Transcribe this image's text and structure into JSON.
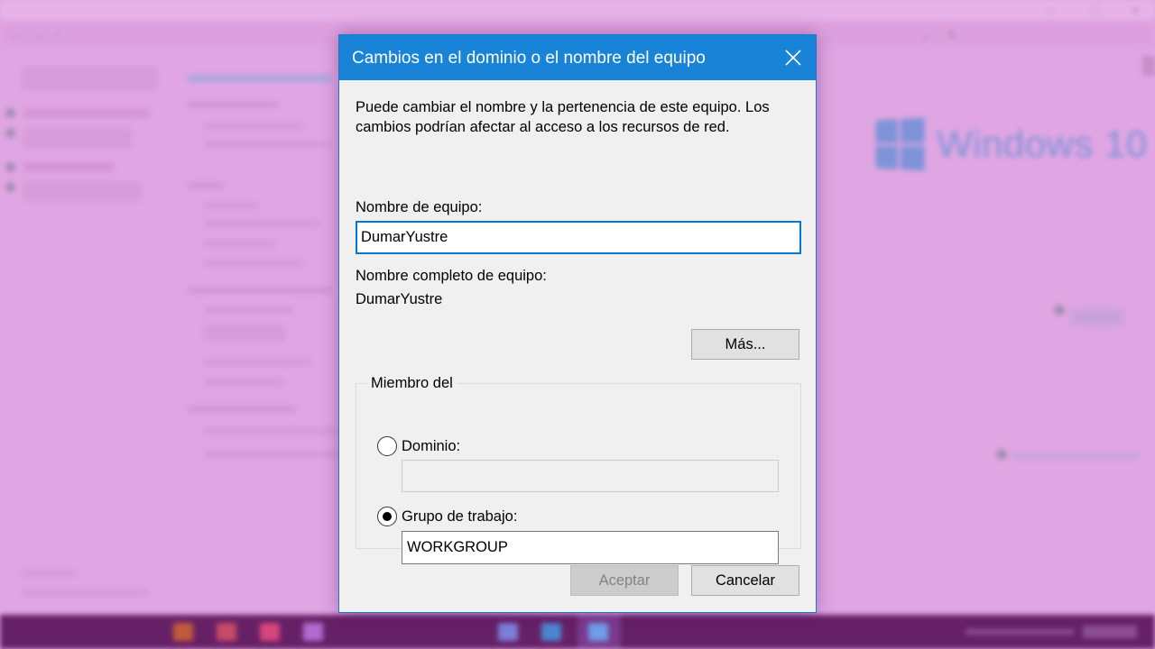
{
  "dialog": {
    "title": "Cambios en el dominio o el nombre del equipo",
    "description": "Puede cambiar el nombre y la pertenencia de este equipo. Los cambios podrían afectar al acceso a los recursos de red.",
    "computer_name_label": "Nombre de equipo:",
    "computer_name_value": "DumarYustre",
    "full_name_label": "Nombre completo de equipo:",
    "full_name_value": "DumarYustre",
    "more_button": "Más...",
    "member_of_legend": "Miembro del",
    "domain_option": "Dominio:",
    "domain_value": "",
    "workgroup_option": "Grupo de trabajo:",
    "workgroup_value": "WORKGROUP",
    "selected_option": "workgroup",
    "ok_button": "Aceptar",
    "cancel_button": "Cancelar"
  },
  "background": {
    "brand_text": "Windows 10",
    "accent_color": "#1883d7"
  }
}
